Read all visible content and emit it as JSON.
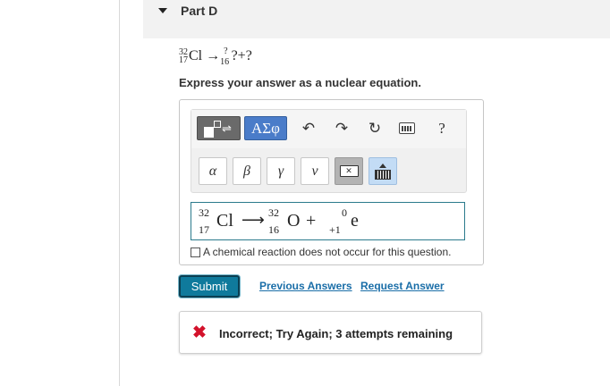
{
  "part": {
    "title": "Part D"
  },
  "question": {
    "reactant_mass": "32",
    "reactant_atomic": "17",
    "reactant_symbol": "Cl",
    "arrow": "→",
    "product_atomic": "16",
    "product_mass": "?",
    "rest": "?+?"
  },
  "instruction": "Express your answer as a nuclear equation.",
  "toolbar": {
    "greek_label": "ΑΣφ",
    "undo_glyph": "↶",
    "redo_glyph": "↷",
    "reset_glyph": "↻",
    "help_label": "?",
    "symbols": [
      "α",
      "β",
      "γ",
      "ν"
    ],
    "backspace_glyph": "✕"
  },
  "answer": {
    "n1_mass": "32",
    "n1_atomic": "17",
    "n1_symbol": "Cl",
    "arrow": "⟶",
    "n2_mass": "32",
    "n2_atomic": "16",
    "n2_symbol": "O",
    "plus": "+",
    "n3_mass": "0",
    "n3_atomic": "+1",
    "n3_symbol": "e"
  },
  "no_reaction_label": "A chemical reaction does not occur for this question.",
  "actions": {
    "submit_label": "Submit",
    "previous_answers_label": "Previous Answers",
    "request_answer_label": "Request Answer"
  },
  "feedback": {
    "icon": "✖",
    "message": "Incorrect; Try Again; 3 attempts remaining",
    "status_color": "#d3122b"
  },
  "colors": {
    "accent": "#0f7a9c",
    "link": "#1a6ea8",
    "greek_button": "#4a7cc9"
  }
}
